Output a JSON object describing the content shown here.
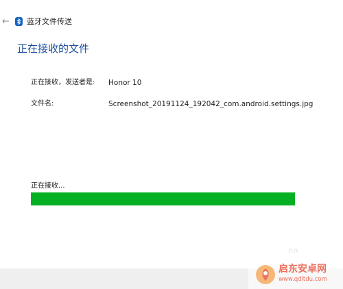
{
  "window": {
    "back_icon": "back-arrow-icon",
    "bluetooth_icon": "bluetooth-icon",
    "title": "蓝牙文件传送"
  },
  "main": {
    "heading": "正在接收的文件",
    "sender_label": "正在接收，发送者是:",
    "sender_value": "Honor 10",
    "filename_label": "文件名:",
    "filename_value": "Screenshot_20191124_192042_com.android.settings.jpg"
  },
  "progress": {
    "label": "正在接收...",
    "fraction": 1.0,
    "color": "#06b025"
  },
  "watermark": {
    "logo_icon": "qidian-anzhuo-logo-icon",
    "title": "启东安卓网",
    "url": "www.qdltdu.com",
    "color": "#e8422b"
  }
}
